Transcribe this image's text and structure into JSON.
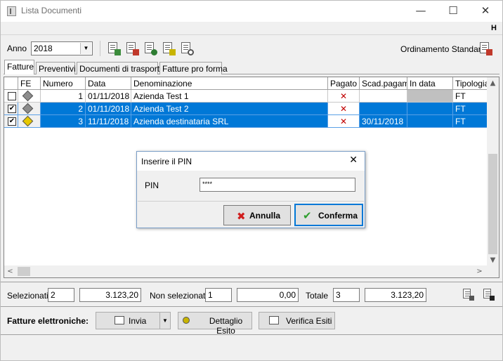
{
  "window": {
    "title": "Lista Documenti",
    "minimize": "—",
    "maximize": "☐",
    "close": "✕",
    "help_flag": "H"
  },
  "toolbar": {
    "anno_label": "Anno",
    "anno_value": "2018",
    "sort_label": "Ordinamento Standard",
    "icons": [
      "new-document-icon",
      "calendar-document-icon",
      "user-document-icon",
      "export-document-icon",
      "search-document-icon"
    ]
  },
  "tabs": [
    {
      "label": "Fatture",
      "active": true
    },
    {
      "label": "Preventivi",
      "active": false
    },
    {
      "label": "Documenti di trasporto",
      "active": false
    },
    {
      "label": "Fatture pro forma",
      "active": false
    }
  ],
  "grid": {
    "columns": [
      "",
      "FE",
      "Numero",
      "Data",
      "Denominazione",
      "Pagato",
      "Scad.pagam.",
      "In data",
      "Tipologia"
    ],
    "rows": [
      {
        "checked": false,
        "fe_color": "#8c8c8c",
        "numero": "1",
        "data": "01/11/2018",
        "denominazione": "Azienda Test 1",
        "pagato": "✕",
        "scadenza": "",
        "in_data": "",
        "tipologia": "FT",
        "selected": false
      },
      {
        "checked": true,
        "fe_color": "#8c8c8c",
        "numero": "2",
        "data": "01/11/2018",
        "denominazione": "Azienda Test 2",
        "pagato": "✕",
        "scadenza": "",
        "in_data": "",
        "tipologia": "FT",
        "selected": true
      },
      {
        "checked": true,
        "fe_color": "#e6c800",
        "numero": "3",
        "data": "11/11/2018",
        "denominazione": "Azienda destinataria SRL",
        "pagato": "✕",
        "scadenza": "30/11/2018",
        "in_data": "",
        "tipologia": "FT",
        "selected": true
      }
    ]
  },
  "dialog": {
    "title": "Inserire il PIN",
    "close": "✕",
    "pin_label": "PIN",
    "pin_value": "****",
    "cancel_label": "Annulla",
    "confirm_label": "Conferma"
  },
  "totals": {
    "selezionati_label": "Selezionati",
    "selezionati_count": "2",
    "selezionati_amount": "3.123,20",
    "non_selezionati_label": "Non selezionati",
    "non_selezionati_count": "1",
    "non_selezionati_amount": "0,00",
    "totale_label": "Totale",
    "totale_count": "3",
    "totale_amount": "3.123,20"
  },
  "footer": {
    "label": "Fatture elettroniche:",
    "invia_label": "Invia",
    "dettaglio_label": "Dettaglio Esito",
    "verifica_label": "Verifica Esiti"
  }
}
